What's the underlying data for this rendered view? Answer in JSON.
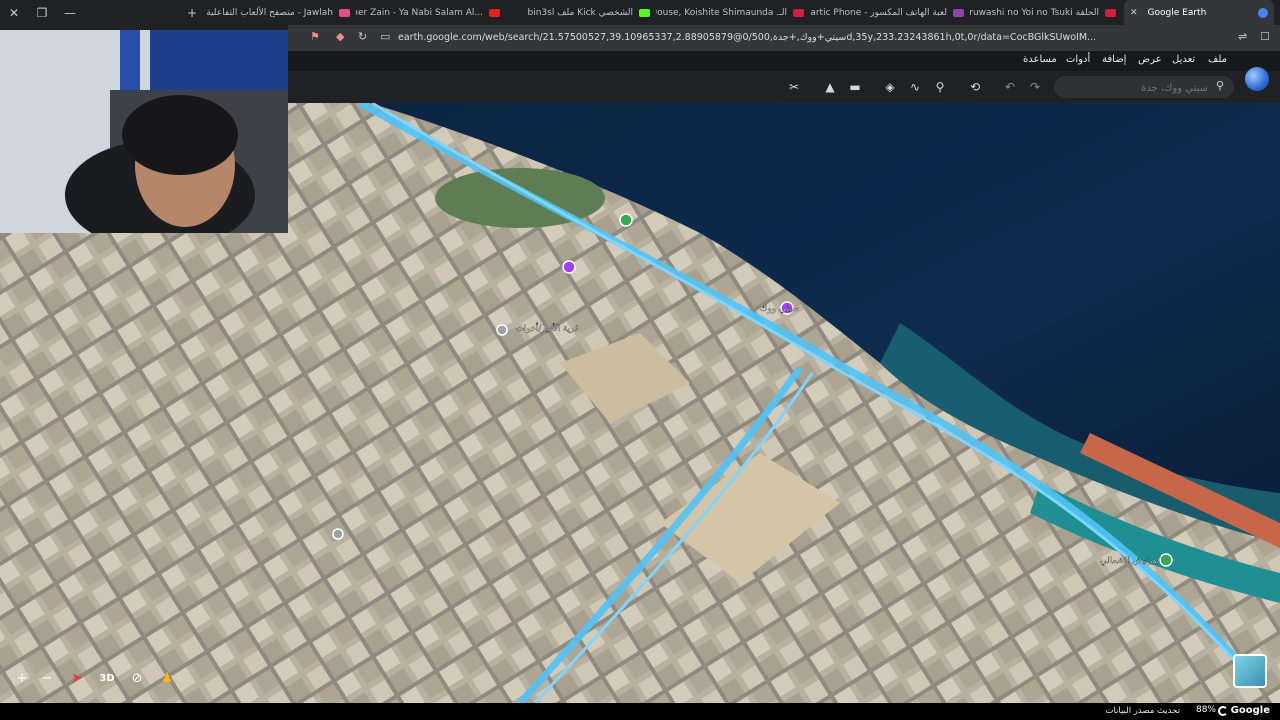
{
  "tabs": [
    {
      "label": "متصفح الألعاب التفاعلية | جولة - Jawlah",
      "fav_color": "#e84c8b"
    },
    {
      "label": "(734) Maher Zain - Ya Nabi Salam Al...",
      "fav_color": "#e62117"
    },
    {
      "label": "bin3sl ملف Kick الشخصي",
      "fav_color": "#53fc18"
    },
    {
      "label": "انمي Douse, Koishite Shimaunda .الـ",
      "fav_color": "#d71e3f"
    },
    {
      "label": "Gartic Phone - لعبة الهاتف المكسور",
      "fav_color": "#8e44ad"
    },
    {
      "label": "انمي Uruwashi no Yoi no Tsuki الحلقة",
      "fav_color": "#d71e3f"
    },
    {
      "label": "Google Earth",
      "fav_color": "#4285f4"
    }
  ],
  "url": "earth.google.com/web/search/21.57500527,39.10965337,2.88905879@0/سيتي+ووك,+جدة,500d,35y,233.23243861h,0t,0r/data=CocBGlkSUwoIM...",
  "menu": {
    "file": "ملف",
    "edit": "تعديل",
    "view": "عرض",
    "add": "إضافة",
    "tools": "أدوات",
    "help": "مساعدة"
  },
  "search": {
    "placeholder": "سيتي ووك، جدة"
  },
  "icons": {
    "search": "search-icon",
    "undo": "undo-icon",
    "redo": "redo-icon",
    "history": "history-icon",
    "placemark": "placemark-icon",
    "path": "path-icon",
    "layers": "layers-icon",
    "ruler": "ruler-icon",
    "image": "image-icon",
    "grid": "grid-off-icon"
  },
  "map_labels": {
    "label1": "سيتي ووك",
    "label2": "قرية الأمير/أخوات",
    "label3": "كورنيش الشمالي"
  },
  "controls": {
    "zoom_in": "+",
    "zoom_out": "−",
    "three_d": "3D"
  },
  "status": {
    "data_source": "تحديث مصدر البيانات",
    "zoom": "88%",
    "brand": "Google"
  },
  "colors": {
    "road_highlight": "#4fc3f7",
    "water": "#0d2847",
    "accent": "#4285f4"
  }
}
